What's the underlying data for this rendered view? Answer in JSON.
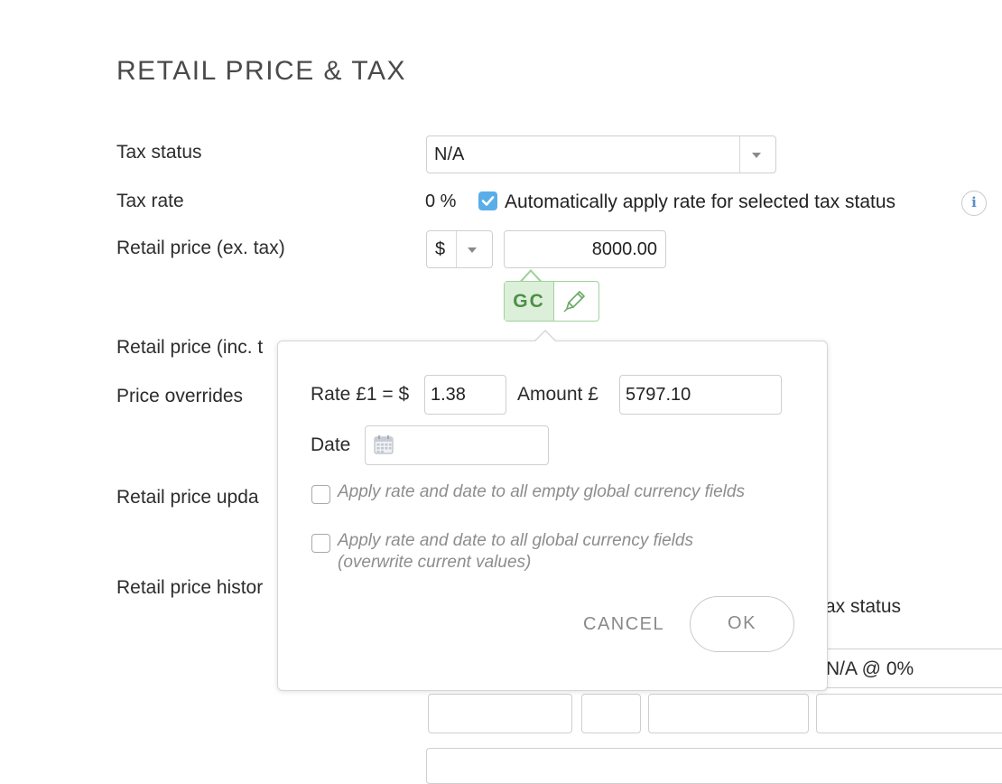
{
  "section": {
    "title": "RETAIL PRICE & TAX"
  },
  "labels": {
    "tax_status": "Tax status",
    "tax_rate": "Tax rate",
    "retail_ex_tax": "Retail price (ex. tax)",
    "retail_inc_tax": "Retail price (inc. t",
    "price_overrides": "Price overrides",
    "retail_updated": "Retail price upda",
    "retail_history": "Retail price histor"
  },
  "tax_status": {
    "selected": "N/A"
  },
  "tax_rate": {
    "value": "0 %",
    "auto_apply_checked": true,
    "auto_apply_label": "Automatically apply rate for selected tax status",
    "info_glyph": "i"
  },
  "retail_ex_tax": {
    "currency": "$",
    "amount": "8000.00"
  },
  "gc_badge": {
    "label": "GC",
    "edit_icon": "pencil-icon"
  },
  "currency_popover": {
    "rate_label": "Rate £1 = $",
    "rate_value": "1.38",
    "amount_label": "Amount £",
    "amount_value": "5797.10",
    "date_label": "Date",
    "date_value": "",
    "date_icon": "calendar-icon",
    "option_empty_label": "Apply rate and date to all empty global currency fields",
    "option_empty_checked": false,
    "option_all_label": "Apply rate and date to all global currency fields (overwrite current values)",
    "option_all_checked": false,
    "cancel_label": "CANCEL",
    "ok_label": "OK"
  },
  "history": {
    "tax_status_header": "ax status",
    "tax_status_value": "N/A @ 0%"
  },
  "colors": {
    "accent_blue": "#5aaee8",
    "gc_green": "#4e8f48",
    "gc_green_bg": "#dcefd9",
    "muted_text": "#8d8d8d"
  }
}
